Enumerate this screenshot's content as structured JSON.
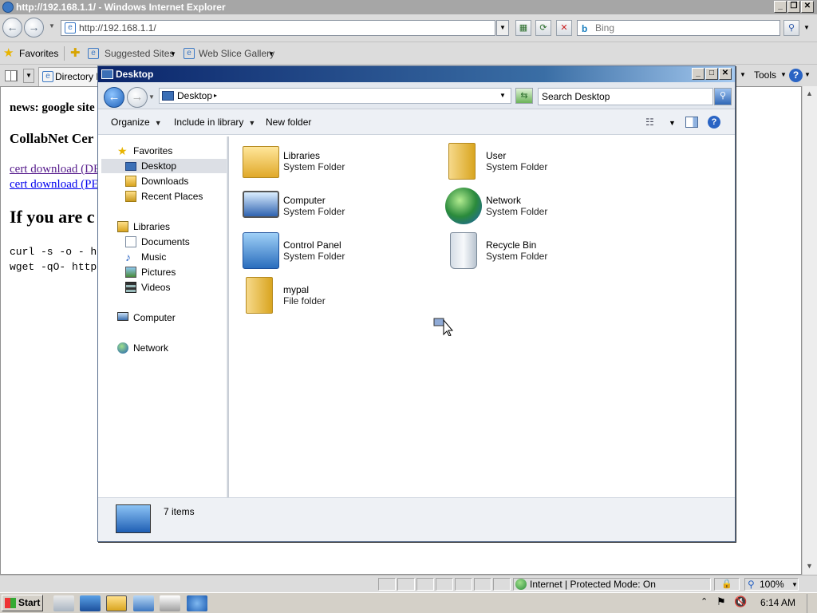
{
  "ie": {
    "title": "http://192.168.1.1/ - Windows Internet Explorer",
    "address": "http://192.168.1.1/",
    "search_placeholder": "Bing",
    "favorites_label": "Favorites",
    "suggested_sites": "Suggested Sites",
    "web_slice_gallery": "Web Slice Gallery",
    "tab_label": "Directory Li",
    "tools_label": "Tools",
    "status_zone": "Internet | Protected Mode: On",
    "zoom": "100%"
  },
  "page": {
    "news": "news: google site",
    "heading2": "CollabNet Cer",
    "link1": "cert download (DE",
    "link2": "cert download (PE",
    "heading1": "If you are c",
    "code1": "curl -s -o - h",
    "code2": "wget -qO- http"
  },
  "explorer": {
    "title": "Desktop",
    "location": "Desktop",
    "search_placeholder": "Search Desktop",
    "toolbar": {
      "organize": "Organize",
      "include": "Include in library",
      "new_folder": "New folder"
    },
    "nav": {
      "favorites": "Favorites",
      "desktop": "Desktop",
      "downloads": "Downloads",
      "recent": "Recent Places",
      "libraries": "Libraries",
      "documents": "Documents",
      "music": "Music",
      "pictures": "Pictures",
      "videos": "Videos",
      "computer": "Computer",
      "network": "Network"
    },
    "files": [
      {
        "name": "Libraries",
        "type": "System Folder"
      },
      {
        "name": "User",
        "type": "System Folder"
      },
      {
        "name": "Computer",
        "type": "System Folder"
      },
      {
        "name": "Network",
        "type": "System Folder"
      },
      {
        "name": "Control Panel",
        "type": "System Folder"
      },
      {
        "name": "Recycle Bin",
        "type": "System Folder"
      },
      {
        "name": "mypal",
        "type": "File folder"
      }
    ],
    "item_count": "7 items"
  },
  "taskbar": {
    "start": "Start",
    "clock": "6:14 AM"
  }
}
